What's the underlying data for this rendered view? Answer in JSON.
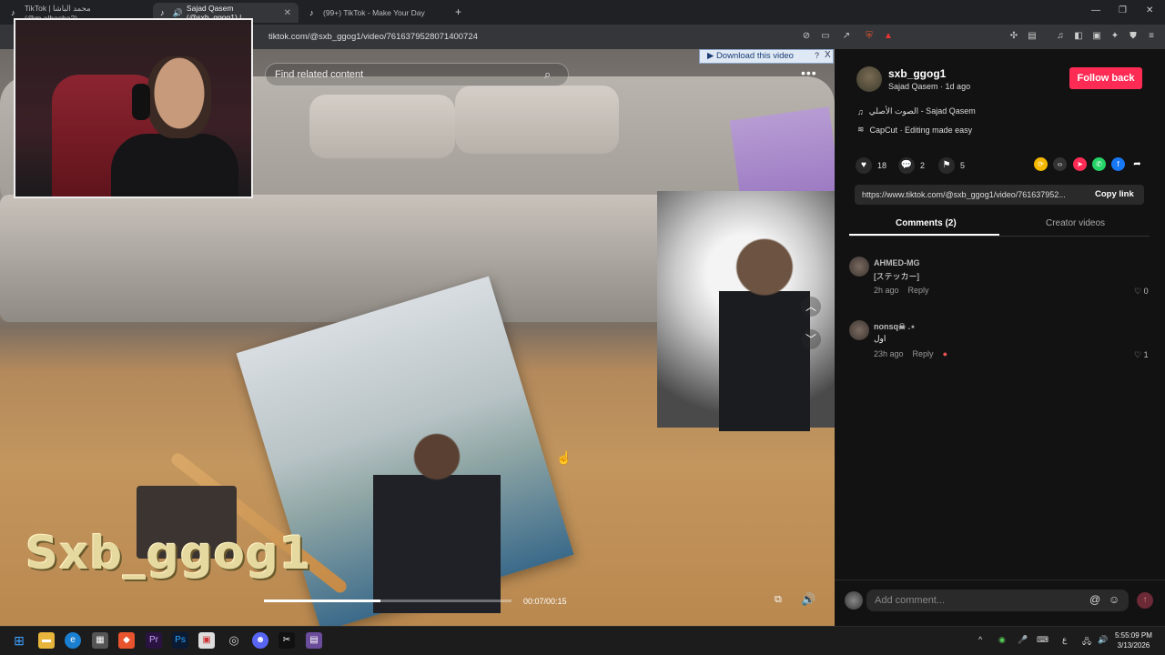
{
  "browser": {
    "tabs": [
      {
        "label": "TikTok | محمد الباشا (@m.albasha2)",
        "active": false
      },
      {
        "label": "Sajad Qasem (@sxb_ggog1) |",
        "active": true
      },
      {
        "label": "(99+) TikTok - Make Your Day",
        "active": false
      }
    ],
    "new_tab": "+",
    "url": "tiktok.com/@sxb_ggog1/video/7616379528071400724"
  },
  "video": {
    "search_placeholder": "Find related content",
    "download_label": "▶ Download this video",
    "download_help": "?",
    "download_close": "X",
    "more": "•••",
    "watermark": "Sxb_ggog1",
    "time": "00:07/00:15",
    "progress": 0.47
  },
  "author": {
    "username": "sxb_ggog1",
    "display_name": "Sajad Qasem",
    "posted": "1d ago",
    "follow_label": "Follow back",
    "music": "الصوت الأصلي - Sajad Qasem",
    "capcut": "CapCut · Editing made easy"
  },
  "stats": {
    "likes": "18",
    "comments": "2",
    "saves": "5"
  },
  "link": {
    "url": "https://www.tiktok.com/@sxb_ggog1/video/761637952...",
    "copy_label": "Copy link"
  },
  "tabs": {
    "comments": "Comments (2)",
    "creator": "Creator videos"
  },
  "comments": [
    {
      "name": "AHMED-MG",
      "text": "[ステッカー]",
      "time": "2h ago",
      "reply": "Reply",
      "likes": "0"
    },
    {
      "name": "nonsq☠ .⋆",
      "text": "اول",
      "time": "23h ago",
      "reply": "Reply",
      "likes": "1"
    }
  ],
  "composer": {
    "placeholder": "Add comment..."
  },
  "taskbar": {
    "lang": "ع",
    "time": "5:55:09 PM",
    "date": "3/13/2026"
  },
  "colors": {
    "accent": "#fe2c55",
    "background": "#121212"
  }
}
